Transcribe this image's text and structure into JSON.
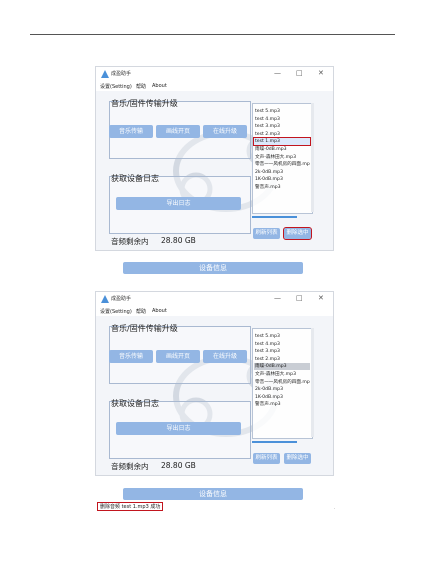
{
  "window": {
    "title": "成盈助手",
    "controls": [
      "—",
      "□",
      "✕"
    ]
  },
  "menu": [
    "设置(Setting)",
    "帮助",
    "About"
  ],
  "section_upgrade": {
    "title": "音乐/固件传输升级",
    "buttons": [
      "音乐传输",
      "画线开页",
      "在线升级"
    ]
  },
  "section_log": {
    "title": "获取设备日志",
    "button": "导出日志"
  },
  "storage": {
    "label": "音频剩余内",
    "value": "28.80 GB"
  },
  "side_buttons": {
    "refresh": "刷新列表",
    "delete": "删除选中"
  },
  "device_info_button": "设备信息",
  "screenshot1": {
    "files": [
      "test 5.mp3",
      "test 4.mp3",
      "test 3.mp3",
      "test 2.mp3",
      "test 1.mp3",
      "雨噪-0dB.mp3",
      "文声-森林田大.mp3",
      "零音一一风机房的四面.mp3",
      "2k-0dB.mp3",
      "1K-0dB.mp3",
      "警音声.mp3"
    ],
    "selected_index": 4
  },
  "screenshot2": {
    "files": [
      "test 5.mp3",
      "test 4.mp3",
      "test 3.mp3",
      "test 2.mp3",
      "雨噪-0dB.mp3",
      "文声-森林田大.mp3",
      "零音一一风机房的四面.mp3",
      "2k-0dB.mp3",
      "1K-0dB.mp3",
      "警音声.mp3"
    ],
    "selected_index": 4
  },
  "status_message": "删除音频 test 1.mp3 成功",
  "page_marker": "·"
}
